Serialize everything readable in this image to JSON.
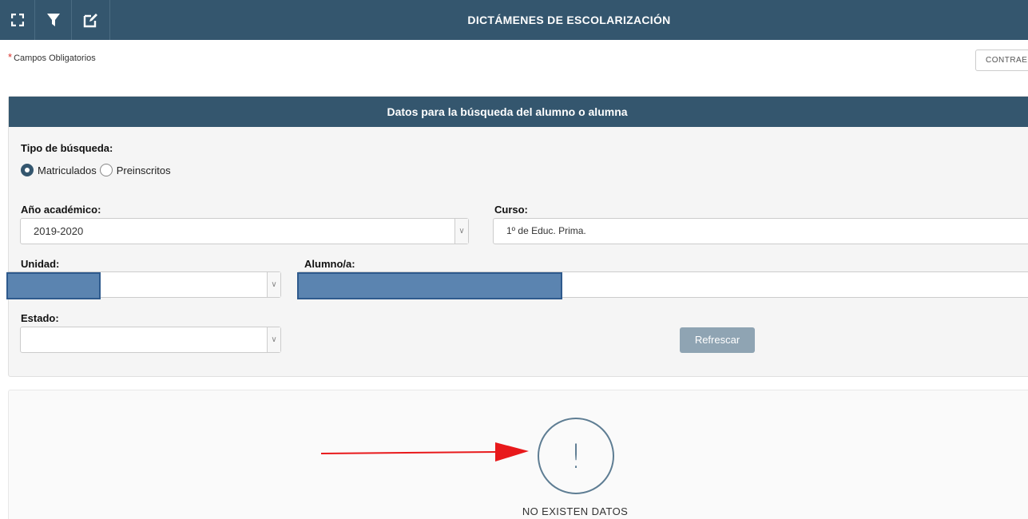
{
  "header": {
    "title": "DICTÁMENES DE ESCOLARIZACIÓN",
    "tools": [
      "fullscreen-icon",
      "filter-icon",
      "edit-icon"
    ]
  },
  "required_note": {
    "star": "*",
    "text": "Campos Obligatorios"
  },
  "collapse_button": "CONTRAE",
  "search_panel": {
    "title": "Datos para la búsqueda del alumno o alumna",
    "search_type": {
      "label": "Tipo de búsqueda:",
      "options": [
        "Matriculados",
        "Preinscritos"
      ],
      "selected": "Matriculados"
    },
    "academic_year": {
      "label": "Año académico:",
      "value": "2019-2020"
    },
    "course": {
      "label": "Curso:",
      "value": "1º de Educ. Prima."
    },
    "unit": {
      "label": "Unidad:",
      "value": ""
    },
    "student": {
      "label": "Alumno/a:",
      "value": ""
    },
    "status": {
      "label": "Estado:",
      "value": ""
    },
    "refresh_button": "Refrescar"
  },
  "result": {
    "icon_glyph": "!",
    "message": "NO EXISTEN DATOS"
  },
  "colors": {
    "header_bg": "#34566e",
    "redaction": "#5b84b0",
    "annotation_arrow": "#e8191b",
    "button_disabled": "#8fa4b3"
  }
}
